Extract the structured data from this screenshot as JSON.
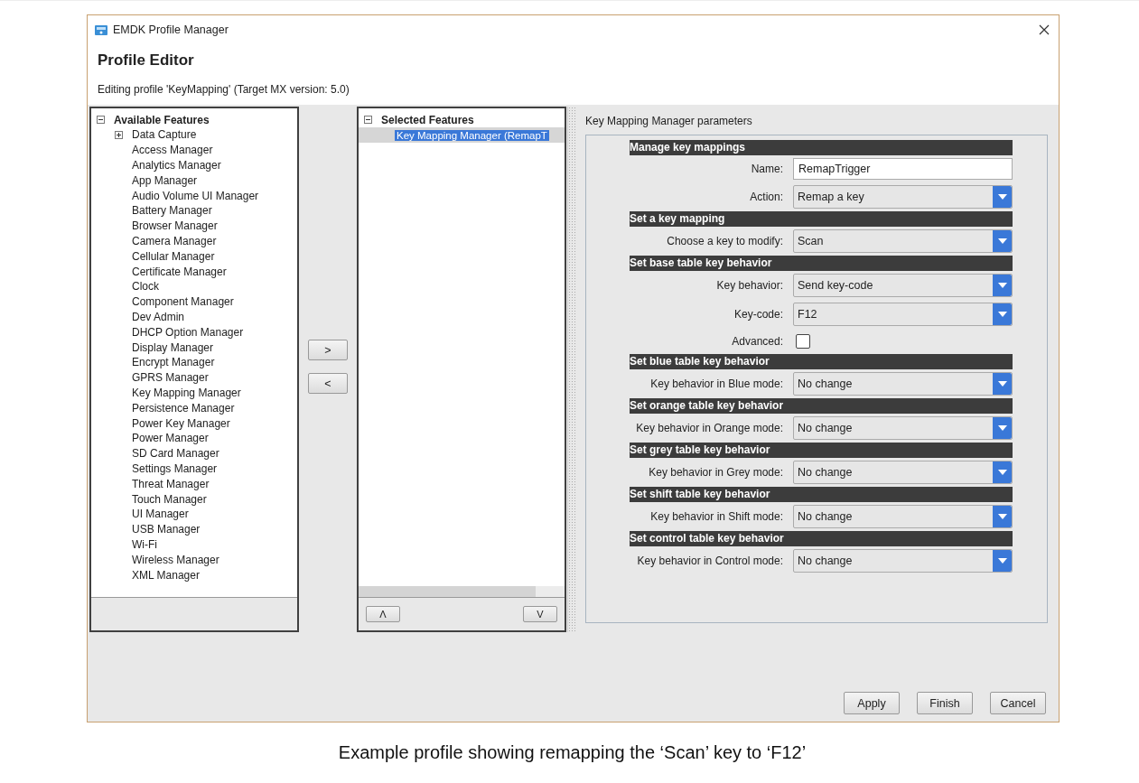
{
  "window": {
    "title": "EMDK Profile Manager",
    "heading": "Profile Editor",
    "subtitle": "Editing profile 'KeyMapping' (Target MX version: 5.0)"
  },
  "available": {
    "title": "Available Features",
    "expanded": true,
    "items": [
      {
        "label": "Data Capture",
        "kind": "group",
        "expanded": false
      },
      {
        "label": "Access Manager",
        "kind": "leaf"
      },
      {
        "label": "Analytics Manager",
        "kind": "leaf"
      },
      {
        "label": "App Manager",
        "kind": "leaf"
      },
      {
        "label": "Audio Volume UI Manager",
        "kind": "leaf"
      },
      {
        "label": "Battery Manager",
        "kind": "leaf"
      },
      {
        "label": "Browser Manager",
        "kind": "leaf"
      },
      {
        "label": "Camera Manager",
        "kind": "leaf"
      },
      {
        "label": "Cellular Manager",
        "kind": "leaf"
      },
      {
        "label": "Certificate Manager",
        "kind": "leaf"
      },
      {
        "label": "Clock",
        "kind": "leaf"
      },
      {
        "label": "Component Manager",
        "kind": "leaf"
      },
      {
        "label": "Dev Admin",
        "kind": "leaf"
      },
      {
        "label": "DHCP Option Manager",
        "kind": "leaf"
      },
      {
        "label": "Display Manager",
        "kind": "leaf"
      },
      {
        "label": "Encrypt Manager",
        "kind": "leaf"
      },
      {
        "label": "GPRS Manager",
        "kind": "leaf"
      },
      {
        "label": "Key Mapping Manager",
        "kind": "leaf"
      },
      {
        "label": "Persistence Manager",
        "kind": "leaf"
      },
      {
        "label": "Power Key Manager",
        "kind": "leaf"
      },
      {
        "label": "Power Manager",
        "kind": "leaf"
      },
      {
        "label": "SD Card Manager",
        "kind": "leaf"
      },
      {
        "label": "Settings Manager",
        "kind": "leaf"
      },
      {
        "label": "Threat Manager",
        "kind": "leaf"
      },
      {
        "label": "Touch Manager",
        "kind": "leaf"
      },
      {
        "label": "UI Manager",
        "kind": "leaf"
      },
      {
        "label": "USB Manager",
        "kind": "leaf"
      },
      {
        "label": "Wi-Fi",
        "kind": "leaf"
      },
      {
        "label": "Wireless Manager",
        "kind": "leaf"
      },
      {
        "label": "XML Manager",
        "kind": "leaf"
      }
    ]
  },
  "move_buttons": [
    ">",
    "<"
  ],
  "selected_features": {
    "title": "Selected Features",
    "expanded": true,
    "items": [
      {
        "label": "Key Mapping Manager (RemapT",
        "selected": true
      }
    ]
  },
  "order_buttons": [
    "Λ",
    "V"
  ],
  "parameters": {
    "title": "Key Mapping Manager parameters",
    "sections": [
      {
        "heading": "Manage key mappings",
        "fields": [
          {
            "label": "Name:",
            "kind": "text",
            "value": "RemapTrigger"
          },
          {
            "label": "Action:",
            "kind": "dropdown",
            "value": "Remap a key"
          }
        ]
      },
      {
        "heading": "Set a key mapping",
        "fields": [
          {
            "label": "Choose a key to modify:",
            "kind": "dropdown",
            "value": "Scan"
          }
        ]
      },
      {
        "heading": "Set base table key behavior",
        "fields": [
          {
            "label": "Key behavior:",
            "kind": "dropdown",
            "value": "Send key-code"
          },
          {
            "label": "Key-code:",
            "kind": "dropdown",
            "value": "F12"
          },
          {
            "label": "Advanced:",
            "kind": "checkbox",
            "checked": false
          }
        ]
      },
      {
        "heading": "Set blue table key behavior",
        "fields": [
          {
            "label": "Key behavior in Blue mode:",
            "kind": "dropdown",
            "value": "No change"
          }
        ]
      },
      {
        "heading": "Set orange table key behavior",
        "fields": [
          {
            "label": "Key behavior in Orange mode:",
            "kind": "dropdown",
            "value": "No change"
          }
        ]
      },
      {
        "heading": "Set grey table key behavior",
        "fields": [
          {
            "label": "Key behavior in Grey mode:",
            "kind": "dropdown",
            "value": "No change"
          }
        ]
      },
      {
        "heading": "Set shift table key behavior",
        "fields": [
          {
            "label": "Key behavior in Shift mode:",
            "kind": "dropdown",
            "value": "No change"
          }
        ]
      },
      {
        "heading": "Set control table key behavior",
        "fields": [
          {
            "label": "Key behavior in Control mode:",
            "kind": "dropdown",
            "value": "No change"
          }
        ]
      }
    ]
  },
  "buttons": [
    "Apply",
    "Finish",
    "Cancel"
  ],
  "caption": "Example profile showing remapping the ‘Scan’ key to ‘F12’"
}
